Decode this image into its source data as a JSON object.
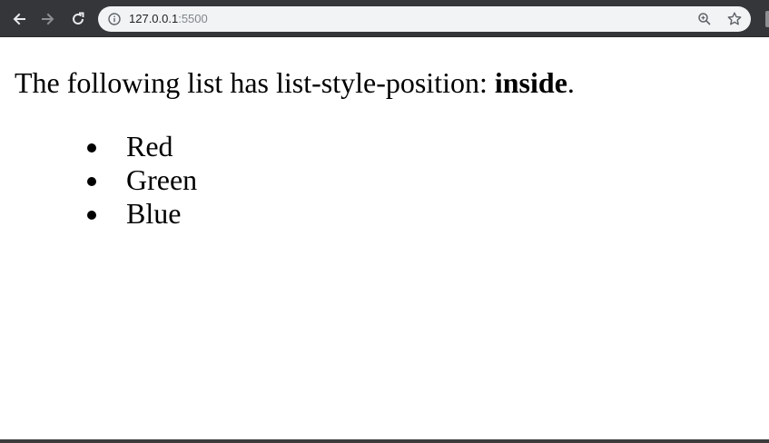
{
  "browser": {
    "url_host": "127.0.0.1",
    "url_port": ":5500",
    "icons": {
      "back": "arrow-left-icon",
      "forward": "arrow-right-icon",
      "reload": "reload-icon",
      "site_info": "info-icon",
      "zoom": "zoom-icon",
      "bookmark": "star-icon"
    },
    "colors": {
      "chrome_bg": "#35363a",
      "omnibox_bg": "#f1f3f4"
    }
  },
  "page": {
    "intro_text": "The following list has list-style-position: ",
    "intro_bold": "inside",
    "intro_end": ".",
    "list_items": [
      "Red",
      "Green",
      "Blue"
    ]
  }
}
